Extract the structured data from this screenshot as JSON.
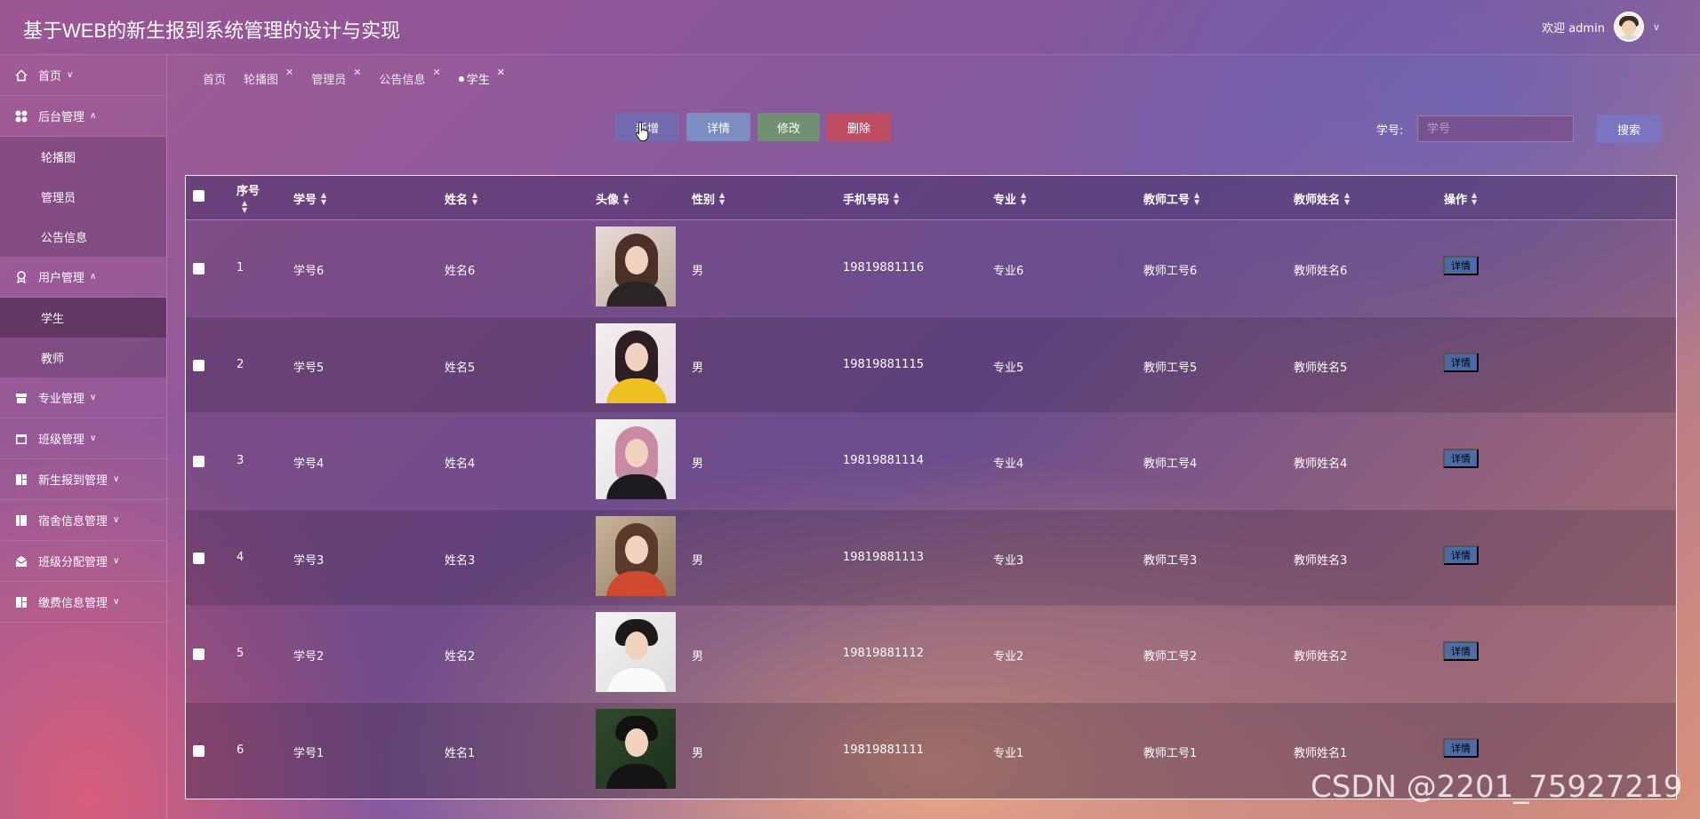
{
  "header": {
    "title": "基于WEB的新生报到系统管理的设计与实现",
    "welcome": "欢迎 admin"
  },
  "sidebar": {
    "items": [
      {
        "label": "首页",
        "icon": "home-icon",
        "arrow": "∨"
      },
      {
        "label": "后台管理",
        "icon": "grid-icon",
        "arrow": "∧",
        "children": [
          "轮播图",
          "管理员",
          "公告信息"
        ]
      },
      {
        "label": "用户管理",
        "icon": "badge-icon",
        "arrow": "∧",
        "children": [
          "学生",
          "教师"
        ]
      },
      {
        "label": "专业管理",
        "icon": "box-icon",
        "arrow": "∨"
      },
      {
        "label": "班级管理",
        "icon": "calendar-icon",
        "arrow": "∨"
      },
      {
        "label": "新生报到管理",
        "icon": "dashboard-icon",
        "arrow": "∨"
      },
      {
        "label": "宿舍信息管理",
        "icon": "columns-icon",
        "arrow": "∨"
      },
      {
        "label": "班级分配管理",
        "icon": "mail-icon",
        "arrow": "∨"
      },
      {
        "label": "缴费信息管理",
        "icon": "dashboard-icon",
        "arrow": "∨"
      }
    ],
    "active_child": "学生"
  },
  "tabs": [
    {
      "label": "首页",
      "closable": false
    },
    {
      "label": "轮播图",
      "closable": true
    },
    {
      "label": "管理员",
      "closable": true
    },
    {
      "label": "公告信息",
      "closable": true
    },
    {
      "label": "学生",
      "closable": true,
      "active": true
    }
  ],
  "toolbar": {
    "add_label": "新增",
    "detail_label": "详情",
    "edit_label": "修改",
    "delete_label": "删除",
    "search_label": "学号:",
    "search_placeholder": "学号",
    "search_button": "搜索"
  },
  "table": {
    "columns": [
      "序号",
      "学号",
      "姓名",
      "头像",
      "性别",
      "手机号码",
      "专业",
      "教师工号",
      "教师姓名",
      "操作"
    ],
    "rows": [
      {
        "index": "1",
        "student_id": "学号6",
        "name": "姓名6",
        "gender": "男",
        "phone": "19819881116",
        "major": "专业6",
        "teacher_id": "教师工号6",
        "teacher_name": "教师姓名6",
        "action": "详情"
      },
      {
        "index": "2",
        "student_id": "学号5",
        "name": "姓名5",
        "gender": "男",
        "phone": "19819881115",
        "major": "专业5",
        "teacher_id": "教师工号5",
        "teacher_name": "教师姓名5",
        "action": "详情"
      },
      {
        "index": "3",
        "student_id": "学号4",
        "name": "姓名4",
        "gender": "男",
        "phone": "19819881114",
        "major": "专业4",
        "teacher_id": "教师工号4",
        "teacher_name": "教师姓名4",
        "action": "详情"
      },
      {
        "index": "4",
        "student_id": "学号3",
        "name": "姓名3",
        "gender": "男",
        "phone": "19819881113",
        "major": "专业3",
        "teacher_id": "教师工号3",
        "teacher_name": "教师姓名3",
        "action": "详情"
      },
      {
        "index": "5",
        "student_id": "学号2",
        "name": "姓名2",
        "gender": "男",
        "phone": "19819881112",
        "major": "专业2",
        "teacher_id": "教师工号2",
        "teacher_name": "教师姓名2",
        "action": "详情"
      },
      {
        "index": "6",
        "student_id": "学号1",
        "name": "姓名1",
        "gender": "男",
        "phone": "19819881111",
        "major": "专业1",
        "teacher_id": "教师工号1",
        "teacher_name": "教师姓名1",
        "action": "详情"
      }
    ]
  },
  "watermark": "CSDN @2201_75927219",
  "colors": {
    "btn_add": "#6e6eb4",
    "btn_detail": "#7896c8",
    "btn_edit": "#6e966e",
    "btn_delete": "#c84b5a",
    "row_action": "#466eaa"
  }
}
